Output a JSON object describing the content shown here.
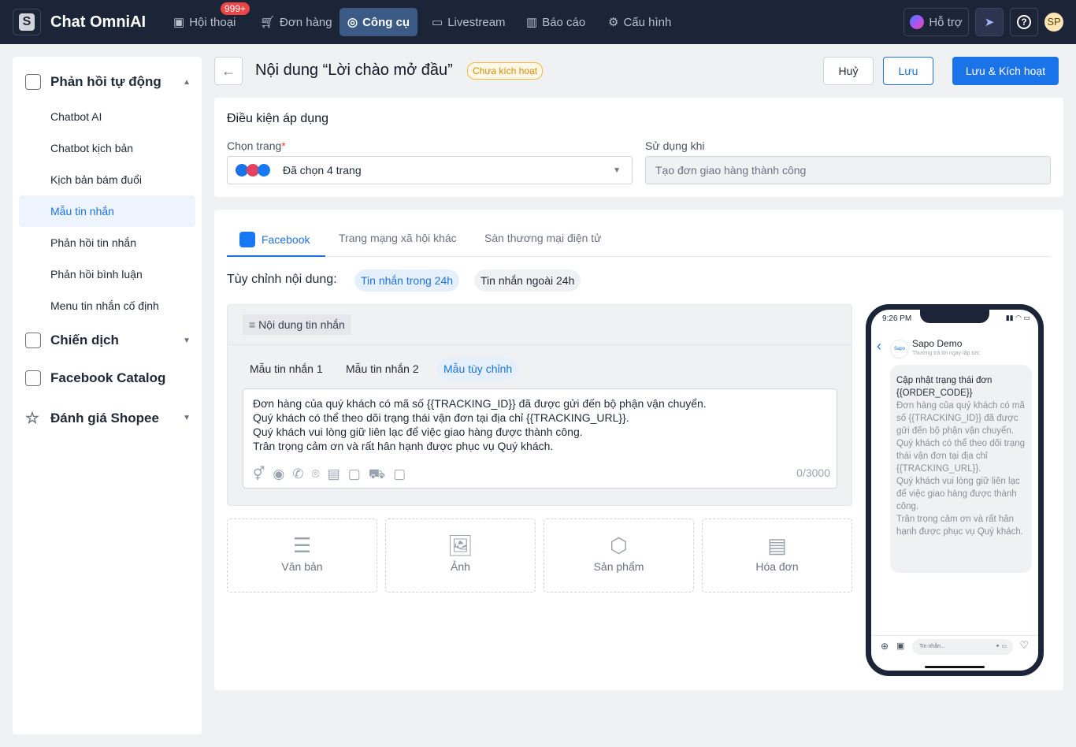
{
  "topbar": {
    "brand": "Chat OmniAI",
    "logo_letter": "S",
    "nav": [
      {
        "label": "Hội thoại",
        "icon": "chat-icon"
      },
      {
        "label": "Đơn hàng",
        "icon": "cart-icon"
      },
      {
        "label": "Công cụ",
        "icon": "tools-icon"
      },
      {
        "label": "Livestream",
        "icon": "video-icon"
      },
      {
        "label": "Báo cáo",
        "icon": "chart-icon"
      },
      {
        "label": "Cấu hình",
        "icon": "gear-icon"
      }
    ],
    "badge": "999+",
    "support": "Hỗ trợ",
    "avatar": "SP"
  },
  "sidebar": {
    "groups": [
      {
        "label": "Phản hồi tự động",
        "items": [
          "Chatbot AI",
          "Chatbot kịch bản",
          "Kịch bản bám đuổi",
          "Mẫu tin nhắn",
          "Phản hồi tin nhắn",
          "Phản hồi bình luận",
          "Menu tin nhắn cố định"
        ]
      },
      {
        "label": "Chiến dịch"
      },
      {
        "label": "Facebook Catalog"
      },
      {
        "label": "Đánh giá Shopee"
      }
    ],
    "active": "Mẫu tin nhắn"
  },
  "header": {
    "title": "Nội dung “Lời chào mở đầu”",
    "status": "Chưa kích hoạt",
    "cancel": "Huỷ",
    "save": "Lưu",
    "save_activate": "Lưu & Kích hoạt"
  },
  "conditions": {
    "title": "Điều kiện áp dụng",
    "page_label": "Chọn trang",
    "required": "*",
    "page_value": "Đã chọn 4 trang",
    "use_label": "Sử dụng khi",
    "use_value": "Tạo đơn giao hàng thành công"
  },
  "channels": {
    "tabs": [
      "Facebook",
      "Trang mạng xã hội khác",
      "Sàn thương mại điện tử"
    ],
    "active": "Facebook"
  },
  "customize": {
    "label": "Tùy chỉnh nội dung:",
    "options": [
      "Tin nhắn trong 24h",
      "Tin nhắn ngoài 24h"
    ],
    "active": "Tin nhắn trong 24h"
  },
  "editor": {
    "section": "Nội dung tin nhắn",
    "templates": [
      "Mẫu tin nhắn 1",
      "Mẫu tin nhắn 2",
      "Mẫu tùy chỉnh"
    ],
    "active": "Mẫu tùy chỉnh",
    "lines": [
      "Đơn hàng của quý khách có mã số {{TRACKING_ID}} đã được gửi đến bộ phận vận chuyển.",
      "Quý khách có thể theo dõi trạng thái vận đơn tại địa chỉ {{TRACKING_URL}}.",
      "Quý khách vui lòng giữ liên lạc để việc giao hàng được thành công.",
      "Trân trọng cảm ơn và rất hân hạnh được phục vụ Quý khách."
    ],
    "counter": "0/3000"
  },
  "attachments": [
    "Văn bản",
    "Ảnh",
    "Sản phẩm",
    "Hóa đơn"
  ],
  "preview": {
    "time": "9:26 PM",
    "name": "Sapo Demo",
    "subtitle": "Thường trả lời ngay lập tức",
    "logo": "Sapo",
    "bubble_title": "Cập nhật trạng thái đơn {{ORDER_CODE}}",
    "bubble_body": "Đơn hàng của quý khách có mã số {{TRACKING_ID}} đã được gửi đến bộ phận vận chuyển.\nQuý khách có thể theo dõi trạng thái vận đơn tại địa chỉ {{TRACKING_URL}}.\nQuý khách vui lòng giữ liên lạc để việc giao hàng được thành công.\nTrân trọng cảm ơn và rất hân hạnh được phục vụ Quý khách.",
    "input_placeholder": "Tin nhắn..."
  },
  "colors": {
    "topbar": "#1b2537",
    "primary": "#1a73e8",
    "active_nav": "#3b5a86",
    "badge": "#ef4444"
  }
}
